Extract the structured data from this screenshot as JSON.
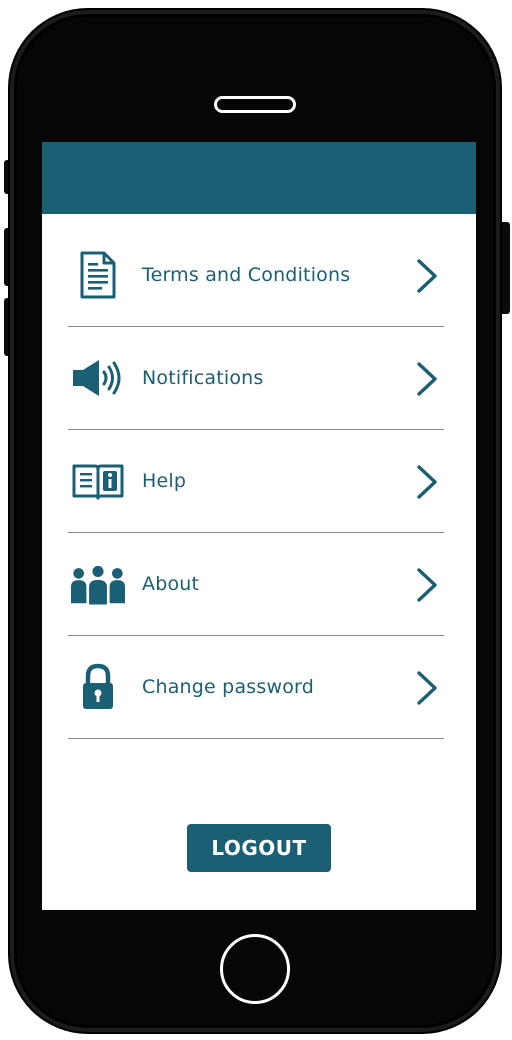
{
  "menu": {
    "items": [
      {
        "label": "Terms and Conditions",
        "icon": "document-icon"
      },
      {
        "label": "Notifications",
        "icon": "speaker-icon"
      },
      {
        "label": "Help",
        "icon": "info-book-icon"
      },
      {
        "label": "About",
        "icon": "group-icon"
      },
      {
        "label": "Change password",
        "icon": "lock-icon"
      }
    ]
  },
  "logout": {
    "label": "LOGOUT"
  },
  "colors": {
    "accent": "#1a5f73",
    "phone_body": "#060606",
    "screen": "#ffffff",
    "divider": "#8a8a8a"
  }
}
